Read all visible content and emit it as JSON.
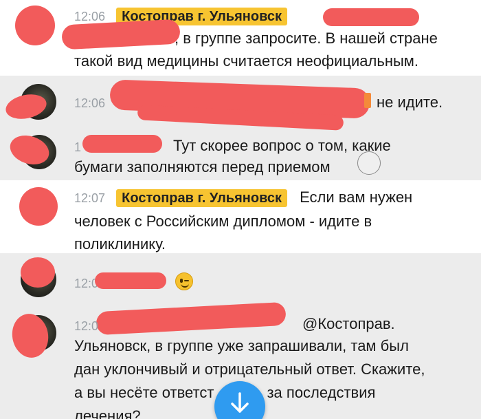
{
  "messages": [
    {
      "time": "12:06",
      "sender_badge": "Костоправ г. Ульяновск",
      "text_line1": ", в группе запросите. В нашей стране",
      "text_line2": "такой вид медицины считается неофициальным."
    },
    {
      "time": "12:06",
      "text": "не идите."
    },
    {
      "time": "1",
      "text_line1": "Тут скорее вопрос о том, какие",
      "text_line2": "бумаги заполняются перед приемом"
    },
    {
      "time": "12:07",
      "sender_badge": "Костоправ г. Ульяновск",
      "text_line1": "Если вам нужен",
      "text_line2": "человек с Российским дипломом - идите в",
      "text_line3": "поликлинику."
    },
    {
      "time": "12:0",
      "emoji": "wink-emoji"
    },
    {
      "time": "12:0",
      "text_line1": "@Костоправ.",
      "text_line2": "Ульяновск, в группе уже запрашивали, там был",
      "text_line3": "дан уклончивый и отрицательный ответ. Скажите,",
      "text_line4": "а вы несёте ответст",
      "text_line4b": "ность за последствия",
      "text_line5": "лечения?"
    }
  ],
  "controls": {
    "scroll_down_icon": "arrow-down-icon"
  },
  "colors": {
    "badge": "#f7c431",
    "redaction": "#f25b5b",
    "fab": "#2f9bf0",
    "timestamp": "#9aa0a6"
  }
}
